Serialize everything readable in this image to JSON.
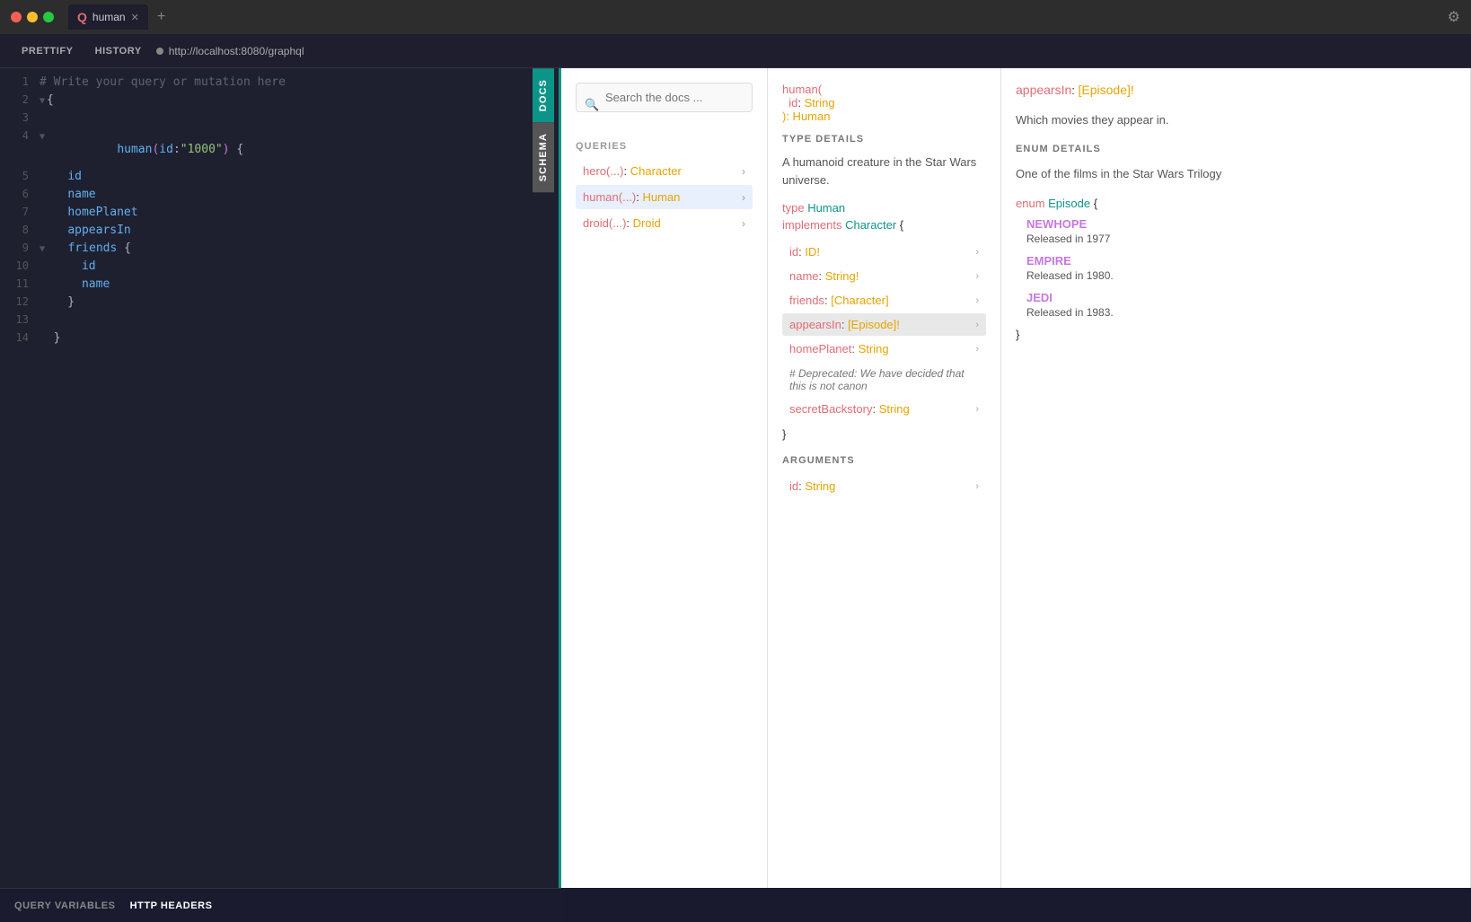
{
  "titlebar": {
    "tab_name": "human",
    "tab_icon": "Q",
    "add_tab_label": "+",
    "gear_label": "⚙"
  },
  "toolbar": {
    "prettify_label": "PRETTIFY",
    "history_label": "HISTORY",
    "url": "http://localhost:8080/graphql"
  },
  "editor": {
    "lines": [
      {
        "num": 1,
        "text": "# Write your query or mutation here",
        "type": "comment"
      },
      {
        "num": 2,
        "text": "{",
        "type": "brace",
        "arrow": "▼"
      },
      {
        "num": 3,
        "text": "",
        "type": "empty"
      },
      {
        "num": 4,
        "text": "  human(id:\"1000\") {",
        "type": "code",
        "arrow": "▼"
      },
      {
        "num": 5,
        "text": "    id",
        "type": "field"
      },
      {
        "num": 6,
        "text": "    name",
        "type": "field"
      },
      {
        "num": 7,
        "text": "    homePlanet",
        "type": "field"
      },
      {
        "num": 8,
        "text": "    appearsIn",
        "type": "field"
      },
      {
        "num": 9,
        "text": "    friends {",
        "type": "field_brace",
        "arrow": "▼"
      },
      {
        "num": 10,
        "text": "      id",
        "type": "field"
      },
      {
        "num": 11,
        "text": "      name",
        "type": "field"
      },
      {
        "num": 12,
        "text": "    }",
        "type": "brace"
      },
      {
        "num": 13,
        "text": "",
        "type": "empty"
      },
      {
        "num": 14,
        "text": "  }",
        "type": "brace"
      }
    ]
  },
  "docs": {
    "search_placeholder": "Search the docs ...",
    "docs_tab_label": "DOCS",
    "schema_tab_label": "SCHEMA",
    "queries_section": "QUERIES",
    "queries": [
      {
        "name": "hero(...)",
        "type": "Character",
        "active": false
      },
      {
        "name": "human(...)",
        "type": "Human",
        "active": true
      },
      {
        "name": "droid(...)",
        "type": "Droid",
        "active": false
      }
    ]
  },
  "type_details": {
    "section_title": "TYPE DETAILS",
    "header_func": "human(",
    "header_id": "id",
    "header_id_type": "String",
    "header_close": "): Human",
    "description": "A humanoid creature in the Star Wars universe.",
    "type_line": "type Human",
    "implements_line": "implements Character {",
    "fields": [
      {
        "name": "id",
        "colon": ":",
        "type": "ID!",
        "active": false
      },
      {
        "name": "name",
        "colon": ":",
        "type": "String!",
        "active": false
      },
      {
        "name": "friends",
        "colon": ":",
        "type": "[Character]",
        "active": false
      },
      {
        "name": "appearsIn",
        "colon": ":",
        "type": "[Episode]!",
        "active": true
      },
      {
        "name": "homePlanet",
        "colon": ":",
        "type": "String",
        "active": false
      }
    ],
    "deprecated_comment": "# Deprecated: We have decided that this is not canon",
    "secret_field": {
      "name": "secretBackstory",
      "colon": ":",
      "type": "String"
    },
    "close_brace": "}",
    "arguments_section": "ARGUMENTS",
    "arg_id": "id",
    "arg_id_type": "String"
  },
  "detail_panel": {
    "field_name": "appearsIn",
    "colon": ":",
    "type_name": "[Episode]!",
    "description": "Which movies they appear in.",
    "enum_section_title": "ENUM DETAILS",
    "enum_desc": "One of the films in the Star Wars Trilogy",
    "enum_open": "enum Episode {",
    "enum_values": [
      {
        "name": "NEWHOPE",
        "desc": "Released in 1977"
      },
      {
        "name": "EMPIRE",
        "desc": "Released in 1980."
      },
      {
        "name": "JEDI",
        "desc": "Released in 1983."
      }
    ],
    "enum_close": "}"
  },
  "bottom_bar": {
    "query_variables_label": "QUERY VARIABLES",
    "http_headers_label": "HTTP HEADERS"
  }
}
